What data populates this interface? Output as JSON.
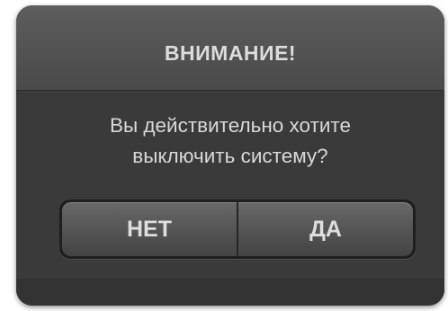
{
  "dialog": {
    "title": "ВНИМАНИЕ!",
    "message_line1": "Вы действительно хотите",
    "message_line2": "выключить систему?",
    "no_label": "НЕТ",
    "yes_label": "ДА"
  },
  "colors": {
    "dialog_bg": "#3e3e3e",
    "title_bg": "#555555",
    "text": "#dcdcdc",
    "button_bg": "#555555"
  }
}
